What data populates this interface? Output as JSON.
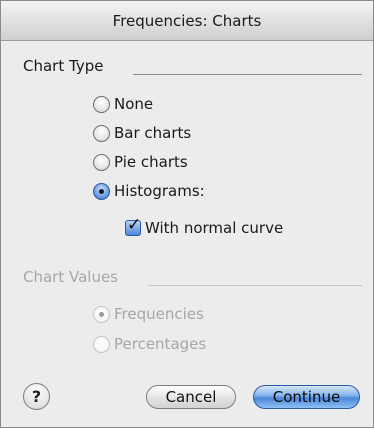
{
  "window": {
    "title": "Frequencies: Charts"
  },
  "chart_type": {
    "label": "Chart Type",
    "options": [
      {
        "label": "None",
        "selected": false
      },
      {
        "label": "Bar charts",
        "selected": false
      },
      {
        "label": "Pie charts",
        "selected": false
      },
      {
        "label": "Histograms:",
        "selected": true
      }
    ],
    "with_normal_curve": {
      "label": "With normal curve",
      "checked": true
    }
  },
  "chart_values": {
    "label": "Chart Values",
    "enabled": false,
    "options": [
      {
        "label": "Frequencies",
        "selected": true
      },
      {
        "label": "Percentages",
        "selected": false
      }
    ]
  },
  "buttons": {
    "help": "?",
    "cancel": "Cancel",
    "continue": "Continue"
  },
  "colors": {
    "accent": "#4c86d8",
    "window_bg": "#ececec",
    "disabled_text": "#a6a6a6"
  }
}
